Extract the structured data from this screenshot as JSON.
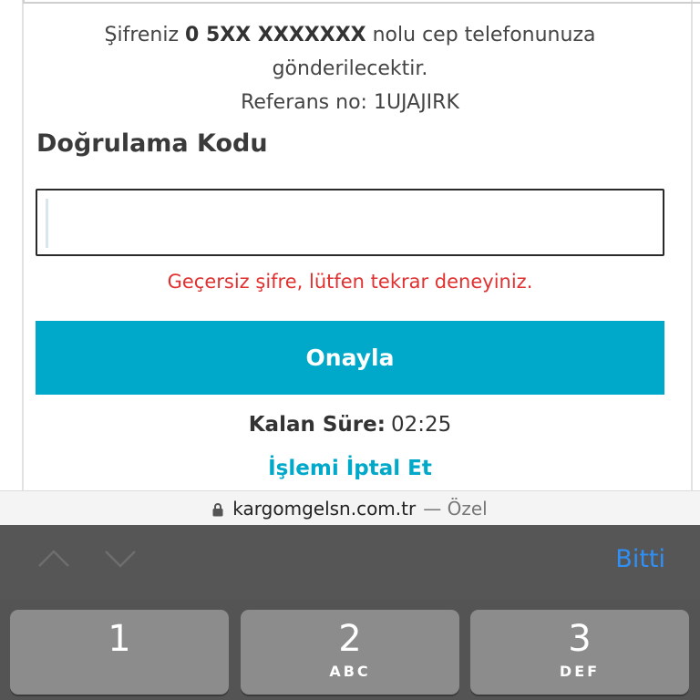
{
  "info": {
    "prefix": "Şifreniz ",
    "phone": "0 5XX XXXXXXX",
    "suffix": " nolu cep telefonunuza",
    "line2": "gönderilecektir.",
    "reference": "Referans no: 1UJAJIRK"
  },
  "form": {
    "label": "Doğrulama Kodu",
    "input_value": "",
    "error": "Geçersiz şifre, lütfen tekrar deneyiniz.",
    "confirm_label": "Onayla"
  },
  "timer": {
    "label": "Kalan Süre:",
    "value": "02:25"
  },
  "cancel_label": "İşlemi İptal Et",
  "browser": {
    "domain": "kargomgelsn.com.tr",
    "mode": "— Özel"
  },
  "keyboard": {
    "done_label": "Bitti",
    "keys": [
      {
        "num": "1",
        "letters": ""
      },
      {
        "num": "2",
        "letters": "ABC"
      },
      {
        "num": "3",
        "letters": "DEF"
      }
    ]
  },
  "colors": {
    "accent": "#00a9c9",
    "error": "#e03131",
    "done": "#2f8ff5"
  }
}
